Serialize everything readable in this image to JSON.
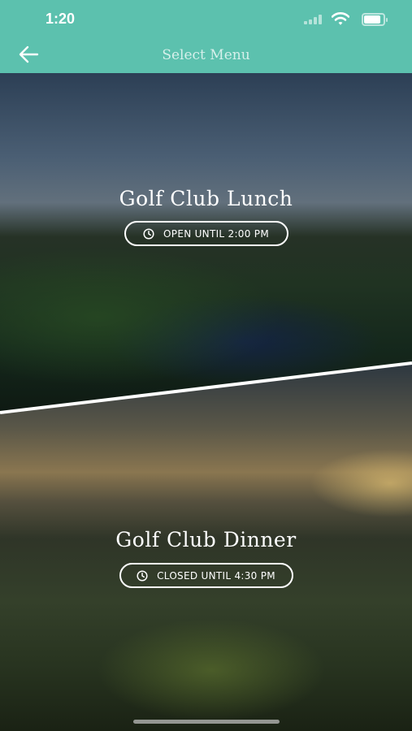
{
  "status_bar": {
    "time": "1:20",
    "battery_level": 0.85
  },
  "header": {
    "title": "Select Menu",
    "back_icon": "arrow-left-icon",
    "background": "#5cc1ae"
  },
  "menus": [
    {
      "title": "Golf Club Lunch",
      "status": "OPEN UNTIL 2:00 PM",
      "icon": "clock-icon"
    },
    {
      "title": "Golf Club Dinner",
      "status": "CLOSED UNTIL 4:30 PM",
      "icon": "clock-icon"
    }
  ]
}
